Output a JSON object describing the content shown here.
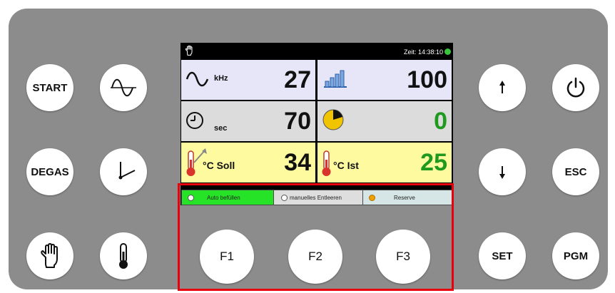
{
  "buttons": {
    "start": "START",
    "degas": "DEGAS",
    "esc": "ESC",
    "set": "SET",
    "pgm": "PGM",
    "f1": "F1",
    "f2": "F2",
    "f3": "F3"
  },
  "icons": {
    "left_col2": [
      "sine-wave-icon",
      "clock-hand-icon",
      "thermometer-icon"
    ],
    "left_col1_bottom": "hand-icon",
    "right": [
      "arrow-up-icon",
      "power-icon",
      "arrow-down-icon"
    ]
  },
  "display": {
    "time": "Zeit: 14:38:10",
    "frequency": {
      "unit": "kHz",
      "value": "27"
    },
    "power": {
      "value": "100"
    },
    "time_setting": {
      "unit": "sec",
      "value": "70"
    },
    "elapsed": {
      "value": "0"
    },
    "temp_set": {
      "unit": "°C Soll",
      "value": "34"
    },
    "temp_actual": {
      "unit": "°C Ist",
      "value": "25"
    }
  },
  "function_bar": [
    "Auto befüllen",
    "manuelles Entleeren",
    "Reserve"
  ],
  "colors": {
    "panel": "#8c8c8c",
    "row_lavender": "#e6e6f8",
    "row_gray": "#dcdcdc",
    "row_yellow": "#fefaa0",
    "value_green": "#1f9a1f",
    "fbar_active": "#27e327",
    "highlight": "#e8000c"
  }
}
